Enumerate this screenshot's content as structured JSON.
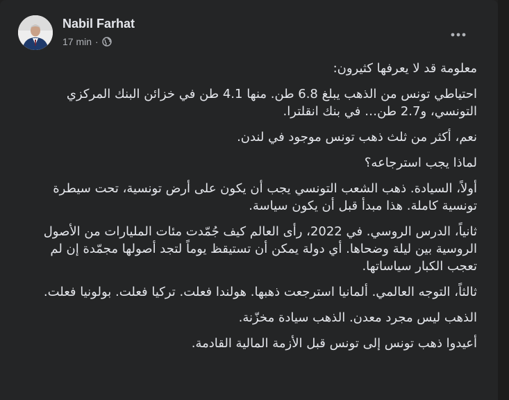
{
  "post": {
    "author": "Nabil Farhat",
    "time": "17 min",
    "separator": "·",
    "privacy_icon": "globe-icon",
    "more_icon": "more-options-icon",
    "paragraphs": [
      "معلومة قد لا يعرفها كثيرون:",
      "احتياطي تونس من الذهب يبلغ 6.8 طن. منها 4.1 طن في خزائن البنك المركزي التونسي، و2.7 طن… في بنك انقلترا.",
      "نعم، أكثر من ثلث ذهب تونس موجود في لندن.",
      "لماذا يجب استرجاعه؟",
      "أولاً، السيادة. ذهب الشعب التونسي يجب أن يكون على أرض تونسية، تحت سيطرة تونسية كاملة. هذا مبدأ قبل أن يكون سياسة.",
      "ثانياً، الدرس الروسي. في 2022، رأى العالم كيف جُمّدت مئات المليارات من الأصول الروسية بين ليلة وضحاها. أي دولة يمكن أن تستيقظ يوماً لتجد أصولها مجمّدة إن لم تعجب الكبار سياساتها.",
      "ثالثاً، التوجه العالمي. ألمانيا استرجعت ذهبها. هولندا فعلت. تركيا فعلت. بولونيا فعلت.",
      "الذهب ليس مجرد معدن. الذهب سيادة مخزّنة.",
      "أعيدوا ذهب تونس إلى تونس قبل الأزمة المالية القادمة."
    ]
  },
  "colors": {
    "card_bg": "#242526",
    "text": "#e4e6eb",
    "secondary_text": "#b0b3b8"
  }
}
